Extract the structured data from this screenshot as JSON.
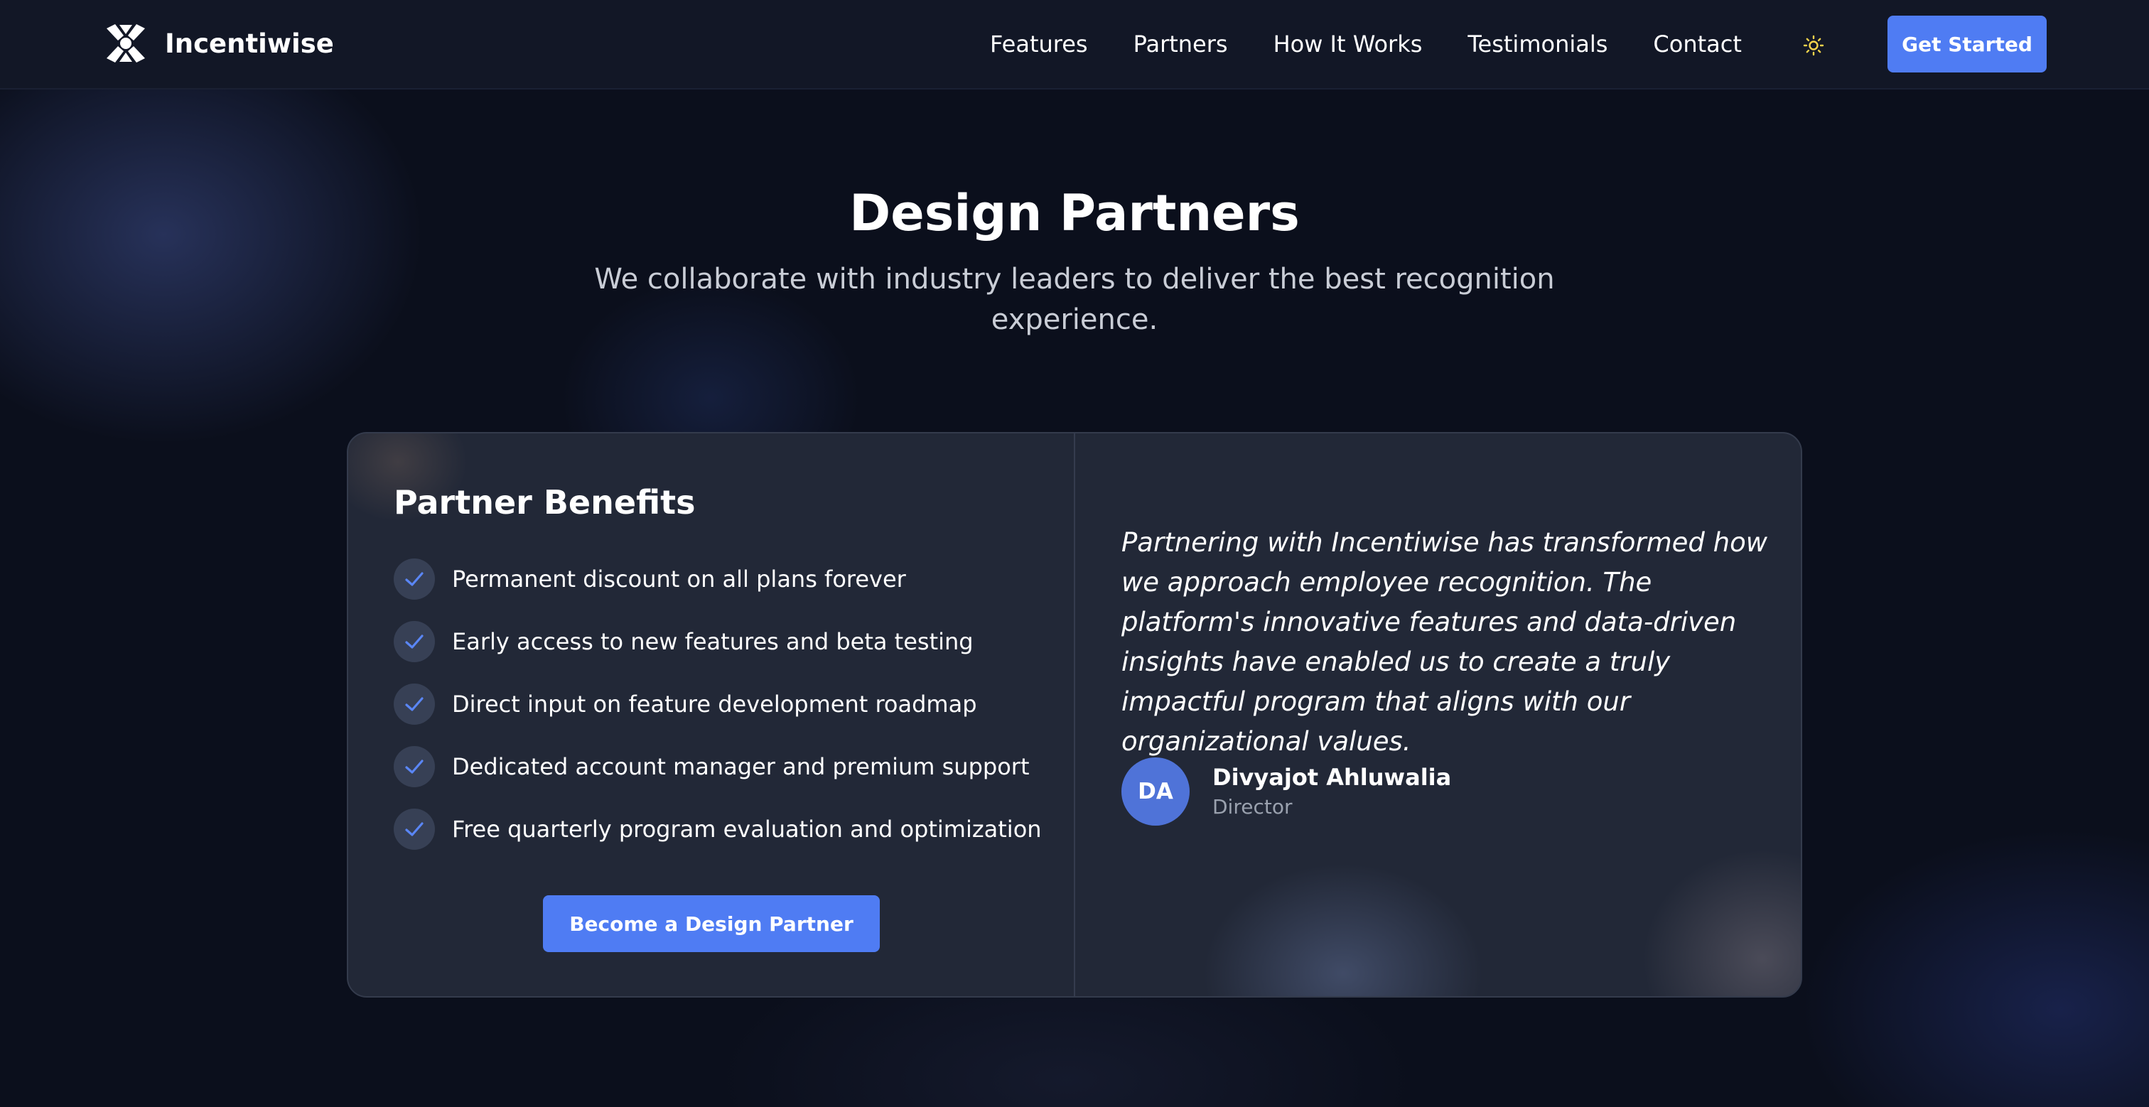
{
  "brand": {
    "name": "Incentiwise",
    "logo_icon": "incentiwise-logo-icon"
  },
  "nav": {
    "links": [
      "Features",
      "Partners",
      "How It Works",
      "Testimonials",
      "Contact"
    ],
    "theme_toggle_icon": "sun-icon",
    "cta_label": "Get Started"
  },
  "hero": {
    "title": "Design Partners",
    "subtitle": "We collaborate with industry leaders to deliver the best recognition experience."
  },
  "benefits": {
    "title": "Partner Benefits",
    "check_icon": "check-icon",
    "items": [
      "Permanent discount on all plans forever",
      "Early access to new features and beta testing",
      "Direct input on feature development roadmap",
      "Dedicated account manager and premium support",
      "Free quarterly program evaluation and optimization"
    ],
    "cta_label": "Become a Design Partner"
  },
  "testimonial": {
    "quote": "Partnering with Incentiwise has transformed how we approach employee recognition. The platform's innovative features and data-driven insights have enabled us to create a truly impactful program that aligns with our organizational values.",
    "author_initials": "DA",
    "author_name": "Divyajot Ahluwalia",
    "author_role": "Director"
  },
  "colors": {
    "accent": "#4f7cf3",
    "background": "#0b0f1c",
    "nav_background": "#121726",
    "card_background": "#222837",
    "avatar": "#4f73d8",
    "sun_icon": "#f2d24c"
  }
}
